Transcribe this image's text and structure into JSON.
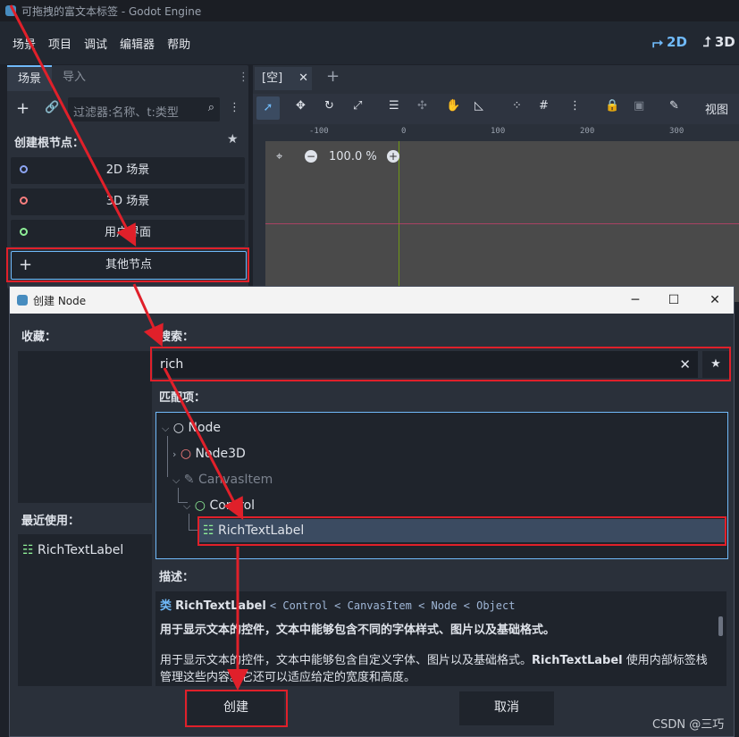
{
  "window": {
    "title": "可拖拽的富文本标签 - Godot Engine",
    "menus": [
      "场景",
      "项目",
      "调试",
      "编辑器",
      "帮助"
    ],
    "mode_2d": "2D",
    "mode_3d": "3D"
  },
  "scene_dock": {
    "tabs": [
      "场景",
      "导入"
    ],
    "filter_placeholder": "过滤器:名称、t:类型",
    "create_root_label": "创建根节点：",
    "buttons": [
      "2D 场景",
      "3D 场景",
      "用户界面",
      "其他节点"
    ]
  },
  "viewport": {
    "tab_label": "[空]",
    "view_label": "视图",
    "zoom": "100.0 %",
    "ruler_ticks": [
      "-100",
      "0",
      "100",
      "200",
      "300"
    ]
  },
  "dialog": {
    "title": "创建 Node",
    "favorites_label": "收藏：",
    "recent_label": "最近使用：",
    "recent_items": [
      "RichTextLabel"
    ],
    "search_label": "搜索：",
    "search_value": "rich",
    "matches_label": "匹配项：",
    "tree": [
      "Node",
      "Node3D",
      "CanvasItem",
      "Control",
      "RichTextLabel"
    ],
    "description_label": "描述：",
    "desc_class_prefix": "类",
    "desc_class_name": "RichTextLabel",
    "desc_inheritance": "< Control < CanvasItem < Node < Object",
    "desc_summary": "用于显示文本的控件，文本中能够包含不同的字体样式、图片以及基础格式。",
    "desc_body_1": "用于显示文本的控件，文本中能够包含自定义字体、图片以及基础格式。",
    "desc_body_bold": "RichTextLabel",
    "desc_body_2": "使用内部标签栈管理这些内容。它还可以适应给定的宽度和高度。",
    "create_button": "创建",
    "cancel_button": "取消"
  },
  "watermark": "CSDN @三巧",
  "colors": {
    "accent": "#70bafa",
    "annotation_red": "#e0202a",
    "node2d_circle": "#8da5f3",
    "node3d_circle": "#fc7f7f",
    "control_circle": "#8eef97",
    "selection": "#3b4b61"
  }
}
